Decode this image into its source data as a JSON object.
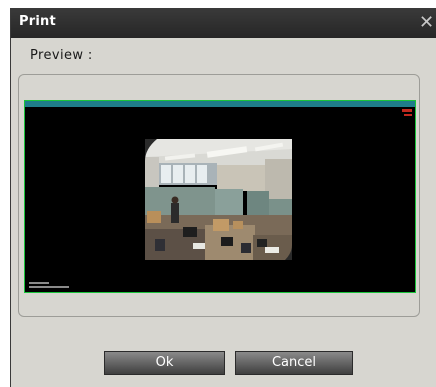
{
  "dialog": {
    "title": "Print",
    "close_glyph": "✕",
    "preview_label": "Preview :",
    "buttons": {
      "ok_label": "Ok",
      "cancel_label": "Cancel"
    }
  },
  "colors": {
    "titlebar": "#2f2f2f",
    "dialog_bg": "#d7d6d0",
    "preview_border": "#19c43a",
    "button_top": "#8a8a8a",
    "button_bottom": "#3f3f3f"
  },
  "icons": {
    "close": "close-icon"
  }
}
